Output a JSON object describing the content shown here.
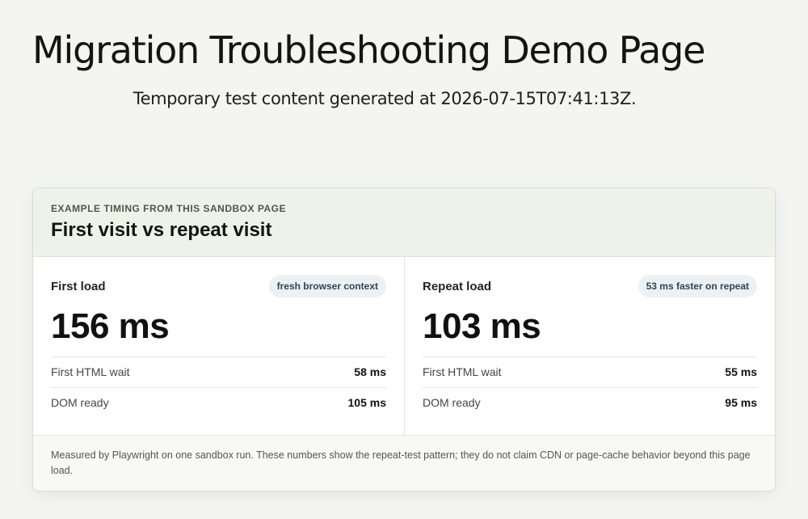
{
  "page": {
    "title": "Migration Troubleshooting Demo Page",
    "subtitle": "Temporary test content generated at 2026-07-15T07:41:13Z."
  },
  "card": {
    "eyebrow": "EXAMPLE TIMING FROM THIS SANDBOX PAGE",
    "title": "First visit vs repeat visit",
    "first_load": {
      "label": "First load",
      "badge": "fresh browser context",
      "value": "156 ms",
      "metrics": [
        {
          "label": "First HTML wait",
          "value": "58 ms"
        },
        {
          "label": "DOM ready",
          "value": "105 ms"
        }
      ]
    },
    "repeat_load": {
      "label": "Repeat load",
      "badge": "53 ms faster on repeat",
      "value": "103 ms",
      "metrics": [
        {
          "label": "First HTML wait",
          "value": "55 ms"
        },
        {
          "label": "DOM ready",
          "value": "95 ms"
        }
      ]
    },
    "footnote": "Measured by Playwright on one sandbox run. These numbers show the repeat-test pattern; they do not claim CDN or page-cache behavior beyond this page load."
  },
  "colors": {
    "background": "#f4f4f2",
    "header_background": "#eef3ea",
    "badge_background": "#edf1f4",
    "badge_text": "#2d4554"
  }
}
